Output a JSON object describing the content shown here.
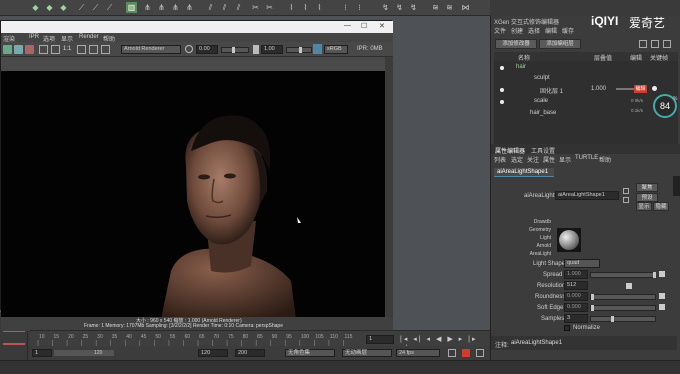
{
  "render_window": {
    "title_buttons": [
      "—",
      "☐",
      "✕"
    ],
    "menu": [
      "渲染",
      "IPR",
      "选项",
      "显示",
      "Render",
      "帮助"
    ],
    "renderer": "Arnold Renderer",
    "exposure": "0.00",
    "gamma": "1.00",
    "ratio": "1:1",
    "colorspace": "sRGB gam",
    "ipr_mem": "IPR: 0MB",
    "status_line1": "大小 : 960 x 540  缩放 : 1.000        (Arnold Renderer)",
    "status_line2": "Frame: 1     Memory: 1707Mb     Sampling: [3/2/2/2/2]     Render Time: 0:10     Camera: perspShape",
    "camera_label": "persp"
  },
  "xgen": {
    "title": "XGen 交互式修饰编辑器",
    "menu": [
      "文件",
      "创建",
      "选择",
      "编辑",
      "缓存"
    ],
    "add_modifier": "添加修改器",
    "add_layer": "添加编组层",
    "col_name": "名称",
    "col_value": "层叠值",
    "col_key": "编辑",
    "col_keyframe": "关键帧",
    "tree": [
      {
        "label": "hair",
        "indent": 0
      },
      {
        "label": "sculpt",
        "indent": 1
      },
      {
        "label": "固化层 1",
        "indent": 2,
        "value": "1.000"
      },
      {
        "label": "scale",
        "indent": 1
      },
      {
        "label": "hair_base",
        "indent": 1
      }
    ],
    "dial_value": "84",
    "dial_unit": "%",
    "dial_up": "0 0k/s",
    "dial_down": "0.1k/s",
    "badge": "编辑"
  },
  "attr_editor": {
    "tabs": [
      "属性编辑器",
      "工具设置"
    ],
    "menu": [
      "列表",
      "选定",
      "关注",
      "属性",
      "显示",
      "TURTLE",
      "帮助"
    ],
    "node_tab": "aiAreaLightShape1",
    "node_label": "aiAreaLight:",
    "node_value": "aiAreaLightShape1",
    "focus_btn": "聚焦",
    "preset_btn": "预设",
    "show_btn": "显示",
    "hide_btn": "隐藏",
    "swatch_lines": [
      "Drawdb",
      "Geometry",
      "Light",
      "Arnold",
      "AreaLight"
    ],
    "attrs": [
      {
        "label": "Light Shape",
        "value": "quad",
        "type": "dropdown"
      },
      {
        "label": "Spread",
        "value": "1.000",
        "type": "slider",
        "level": 1.0
      },
      {
        "label": "Resolution",
        "value": "512",
        "type": "field"
      },
      {
        "label": "Roundness",
        "value": "0.000",
        "type": "slider",
        "level": 0.0
      },
      {
        "label": "Soft Edge",
        "value": "0.000",
        "type": "slider",
        "level": 0.0
      },
      {
        "label": "Samples",
        "value": "3",
        "type": "slider",
        "level": 0.3
      },
      {
        "label": "Normalize",
        "value": "",
        "type": "checkbox"
      }
    ],
    "notes_label": "注释:",
    "notes_value": "aiAreaLightShape1"
  },
  "watermark": "爱奇艺",
  "watermark_logo": "iQIYI",
  "timeline": {
    "ticks": [
      "10",
      "15",
      "20",
      "25",
      "30",
      "35",
      "40",
      "45",
      "50",
      "55",
      "60",
      "65",
      "70",
      "75",
      "80",
      "85",
      "90",
      "95",
      "100",
      "105",
      "110",
      "115"
    ],
    "current_frame": "1"
  },
  "range": {
    "start": "1",
    "inner_end": "120",
    "end": "120",
    "max": "200",
    "char_set": "无角色集",
    "anim_layer": "无动画层",
    "fps": "24 fps"
  },
  "colors": {
    "accent_blue": "#5285a6",
    "shelf_icon": "#9fd49f",
    "badge_red": "#d23a2a"
  }
}
